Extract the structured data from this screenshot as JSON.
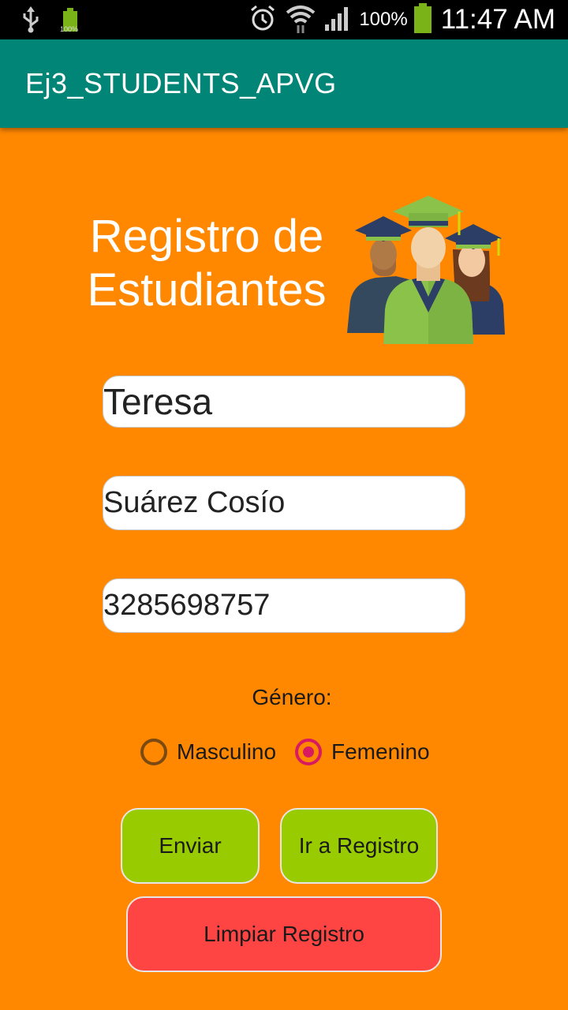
{
  "status_bar": {
    "icons": [
      "usb-icon",
      "battery-small-icon",
      "alarm-icon",
      "wifi-icon",
      "signal-icon",
      "battery-icon"
    ],
    "battery_small_label": "100%",
    "battery_percent": "100%",
    "time": "11:47 AM"
  },
  "app_bar": {
    "title": "Ej3_STUDENTS_APVG"
  },
  "form": {
    "heading_line1": "Registro de",
    "heading_line2": "Estudiantes",
    "logo_icon": "graduates-icon",
    "first_name": "Teresa",
    "last_name": "Suárez Cosío",
    "phone": "3285698757",
    "gender_label": "Género:",
    "gender_options": [
      "Masculino",
      "Femenino"
    ],
    "gender_selected": "Femenino",
    "buttons": {
      "send": "Enviar",
      "go_to_registry": "Ir a Registro",
      "clear": "Limpiar Registro"
    }
  },
  "colors": {
    "background": "#ff8800",
    "app_bar": "#008577",
    "button_green": "#99cc00",
    "button_red": "#ff4444",
    "radio_selected": "#d81b60"
  }
}
